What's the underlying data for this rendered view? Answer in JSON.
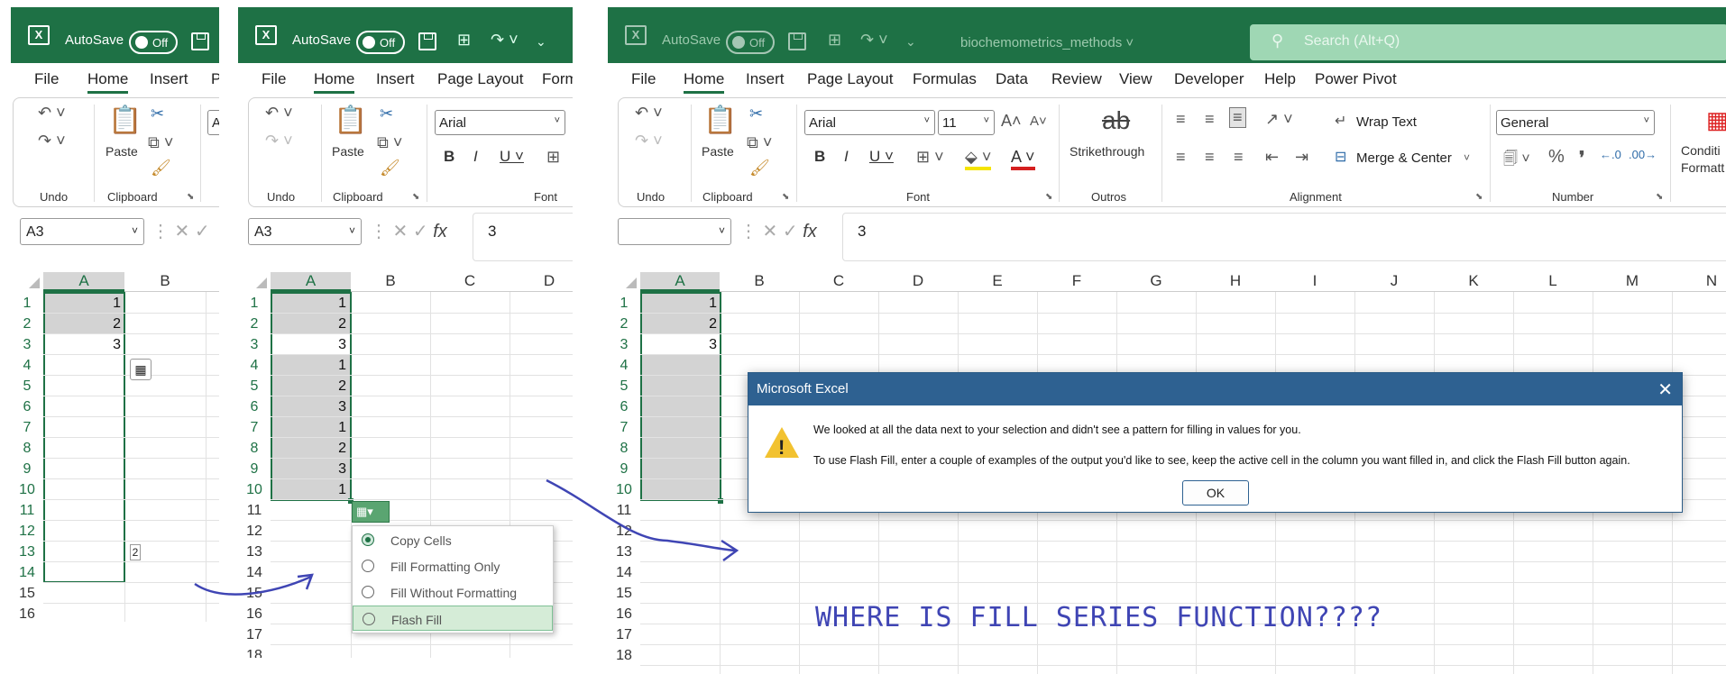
{
  "app": {
    "autosave_label": "AutoSave",
    "toggle_state": "Off",
    "doc_name": "biochemometrics_methods",
    "search_placeholder": "Search (Alt+Q)"
  },
  "tabs_short": [
    "File",
    "Home",
    "Insert",
    "P"
  ],
  "tabs_mid": [
    "File",
    "Home",
    "Insert",
    "Page Layout",
    "Form"
  ],
  "tabs_full": [
    "File",
    "Home",
    "Insert",
    "Page Layout",
    "Formulas",
    "Data",
    "Review",
    "View",
    "Developer",
    "Help",
    "Power Pivot"
  ],
  "ribbon": {
    "undo": "Undo",
    "clipboard": "Clipboard",
    "paste": "Paste",
    "font": "Font",
    "font_name": "Arial",
    "font_size": "11",
    "strikethrough": "Strikethrough",
    "outros": "Outros",
    "alignment": "Alignment",
    "wrap_text": "Wrap Text",
    "merge_center": "Merge & Center",
    "number": "Number",
    "number_format": "General",
    "conditional_1": "Conditi",
    "conditional_2": "Formatt",
    "font_short": "A"
  },
  "namebox": {
    "p1": "A3",
    "p2": "A3",
    "p3": ""
  },
  "formula": {
    "p2": "3",
    "p3": "3"
  },
  "columns_p1": [
    "A",
    "B"
  ],
  "columns_p2": [
    "A",
    "B",
    "C",
    "D"
  ],
  "columns_p3": [
    "A",
    "B",
    "C",
    "D",
    "E",
    "F",
    "G",
    "H",
    "I",
    "J",
    "K",
    "L",
    "M",
    "N"
  ],
  "rows_p1": [
    "1",
    "2",
    "3",
    "4",
    "5",
    "6",
    "7",
    "8",
    "9",
    "10",
    "11",
    "12",
    "13",
    "14",
    "15",
    "16"
  ],
  "rows_p2": [
    "1",
    "2",
    "3",
    "4",
    "5",
    "6",
    "7",
    "8",
    "9",
    "10",
    "11",
    "12",
    "13",
    "14",
    "15",
    "16",
    "17",
    "18"
  ],
  "rows_p3": [
    "1",
    "2",
    "3",
    "4",
    "5",
    "6",
    "7",
    "8",
    "9",
    "10",
    "11",
    "12",
    "13",
    "14",
    "15",
    "16",
    "17",
    "18"
  ],
  "values_p1": [
    "1",
    "2",
    "3"
  ],
  "values_p2": [
    "1",
    "2",
    "3",
    "1",
    "2",
    "3",
    "1",
    "2",
    "3",
    "1"
  ],
  "values_p3": [
    "1",
    "2",
    "3"
  ],
  "fill_counter": "2",
  "autofill_menu": {
    "items": [
      "Copy Cells",
      "Fill Formatting Only",
      "Fill Without Formatting",
      "Flash Fill"
    ],
    "selected": "Copy Cells",
    "highlighted": "Flash Fill"
  },
  "dialog": {
    "title": "Microsoft Excel",
    "line1": "We looked at all the data next to your selection and didn't see a pattern for filling in values for you.",
    "line2": "To use Flash Fill, enter a couple of examples of the output you'd like to see, keep the active cell in the column you want filled in, and click the Flash Fill button again.",
    "ok": "OK"
  },
  "annotation": "WHERE IS FILL SERIES FUNCTION????",
  "colors": {
    "excel_green": "#1e7145",
    "dialog_blue": "#2e6191",
    "ink": "#3f45b4"
  }
}
